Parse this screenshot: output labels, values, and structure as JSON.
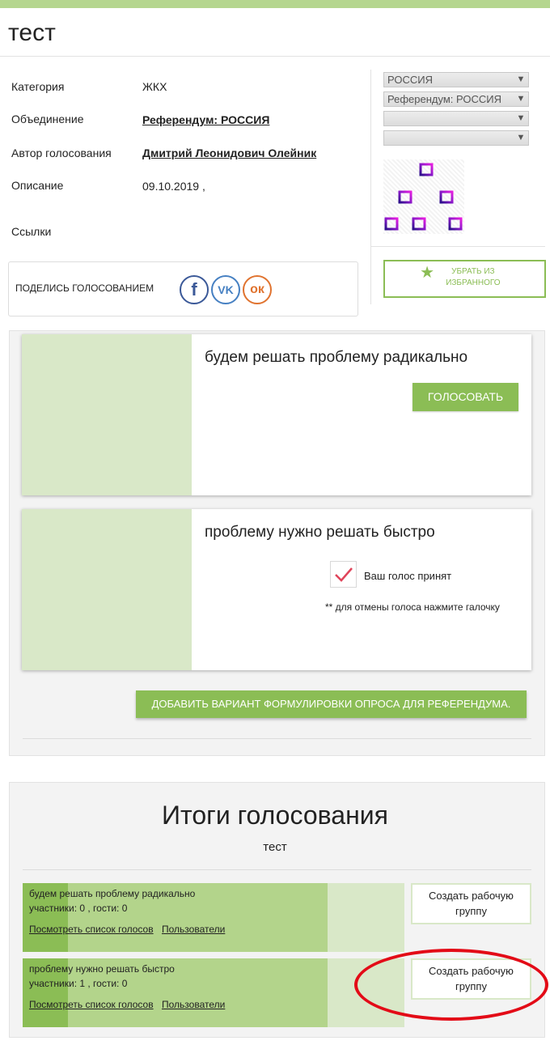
{
  "page": {
    "title": "тест"
  },
  "info": {
    "category_label": "Категория",
    "category_value": "ЖКХ",
    "association_label": "Объединение",
    "association_value": "Референдум: РОССИЯ",
    "author_label": "Автор голосования",
    "author_value": "Дмитрий Леонидович Олейник",
    "description_label": "Описание",
    "description_value": "09.10.2019 ,",
    "links_label": "Ссылки"
  },
  "share": {
    "label": "ПОДЕЛИСЬ ГОЛОСОВАНИЕМ",
    "icons": [
      "facebook-icon",
      "vk-icon",
      "odnoklassniki-icon"
    ]
  },
  "filters": {
    "select1": "РОССИЯ",
    "select2": "Референдум: РОССИЯ",
    "select3": "",
    "select4": ""
  },
  "favorite": {
    "label": "УБРАТЬ ИЗ ИЗБРАННОГО",
    "icon": "star-icon"
  },
  "options": [
    {
      "text": "будем решать проблему радикально",
      "vote_label": "ГОЛОСОВАТЬ"
    },
    {
      "text": "проблему нужно решать быстро",
      "accepted_label": "Ваш голос принят",
      "cancel_note": "** для отмены голоса нажмите галочку"
    }
  ],
  "add_option_label": "ДОБАВИТЬ ВАРИАНТ ФОРМУЛИРОВКИ ОПРОСА ДЛЯ РЕФЕРЕНДУМА.",
  "results": {
    "title": "Итоги голосования",
    "subtitle": "тест",
    "rows": [
      {
        "name": "будем решать проблему радикально",
        "stats": "участники: 0 , гости: 0",
        "view_votes": "Посмотреть список голосов",
        "users": "Пользователи",
        "create_group": "Создать рабочую группу"
      },
      {
        "name": "проблему нужно решать быстро",
        "stats": "участники: 1 , гости: 0",
        "view_votes": "Посмотреть список голосов",
        "users": "Пользователи",
        "create_group": "Создать рабочую группу"
      }
    ]
  },
  "colors": {
    "accent": "#8bbd55",
    "light_green": "#d9e8c8",
    "mid_green": "#b3d48b",
    "highlight": "#e30b17"
  }
}
